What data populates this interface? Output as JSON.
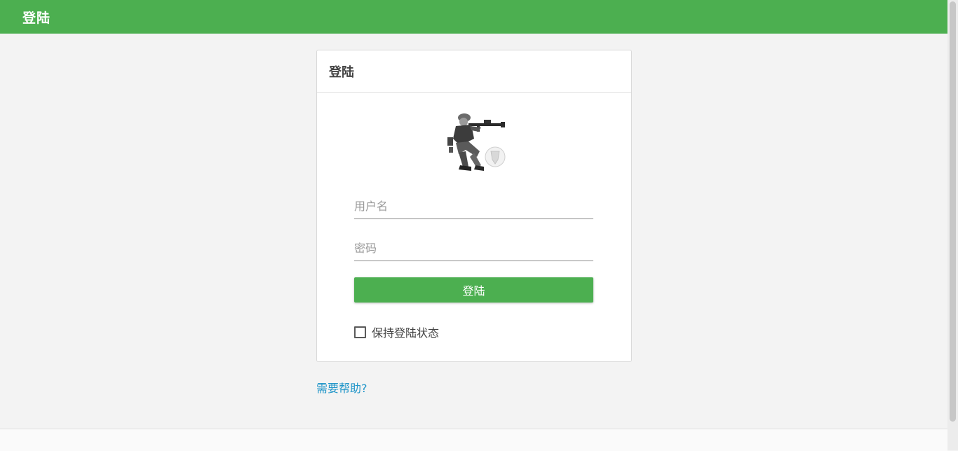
{
  "header": {
    "title": "登陆"
  },
  "login_card": {
    "title": "登陆",
    "avatar_icon": "soldier-illustration-icon",
    "username": {
      "value": "",
      "placeholder": "用户名"
    },
    "password": {
      "value": "",
      "placeholder": "密码"
    },
    "submit_label": "登陆",
    "remember_me": {
      "label": "保持登陆状态",
      "checked": false
    }
  },
  "help_link": "需要帮助?",
  "colors": {
    "primary": "#4caf50",
    "link": "#2196c9",
    "background": "#f3f3f3"
  }
}
